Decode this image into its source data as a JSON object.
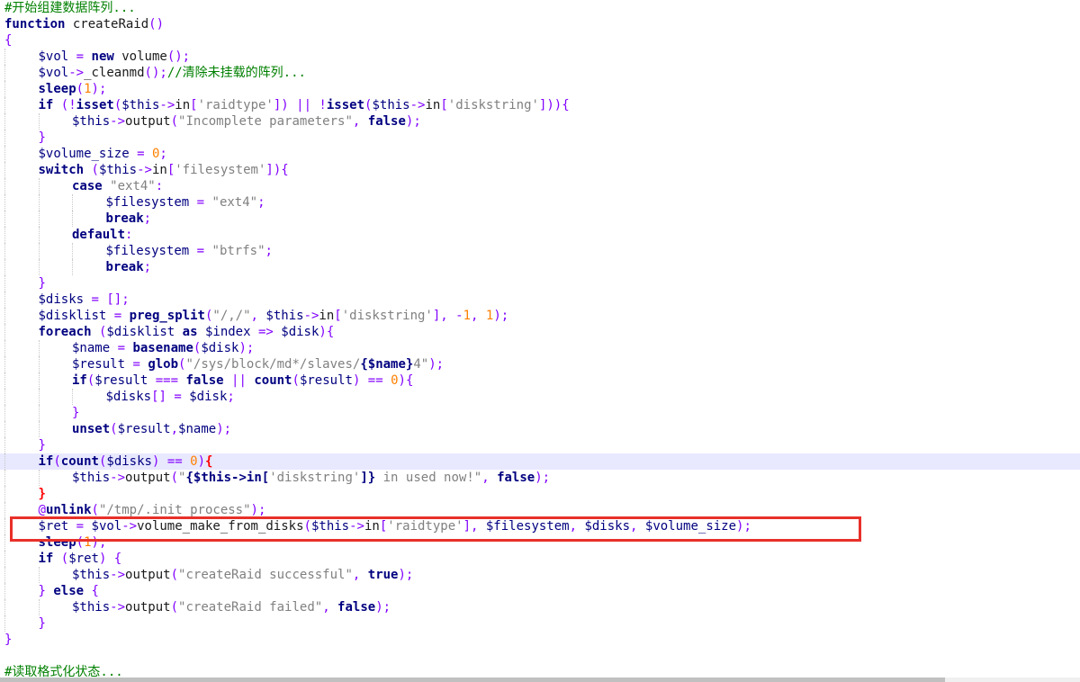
{
  "editor": {
    "lines": [
      {
        "indent": 0,
        "tokens": [
          [
            "cmt",
            "#开始组建数据阵列..."
          ]
        ]
      },
      {
        "indent": 0,
        "tokens": [
          [
            "kw",
            "function"
          ],
          [
            "plain",
            " createRaid"
          ],
          [
            "op",
            "()"
          ]
        ]
      },
      {
        "indent": 0,
        "tokens": [
          [
            "op",
            "{"
          ]
        ]
      },
      {
        "indent": 1,
        "tokens": [
          [
            "var",
            "$vol"
          ],
          [
            "op",
            " = "
          ],
          [
            "kw",
            "new"
          ],
          [
            "plain",
            " volume"
          ],
          [
            "op",
            "();"
          ]
        ]
      },
      {
        "indent": 1,
        "tokens": [
          [
            "var",
            "$vol"
          ],
          [
            "op",
            "->"
          ],
          [
            "plain",
            "_cleanmd"
          ],
          [
            "op",
            "();"
          ],
          [
            "cmt",
            "//清除未挂载的阵列..."
          ]
        ]
      },
      {
        "indent": 1,
        "tokens": [
          [
            "fn",
            "sleep"
          ],
          [
            "op",
            "("
          ],
          [
            "num",
            "1"
          ],
          [
            "op",
            ");"
          ]
        ]
      },
      {
        "indent": 1,
        "tokens": [
          [
            "kw",
            "if"
          ],
          [
            "op",
            " (!"
          ],
          [
            "fn",
            "isset"
          ],
          [
            "op",
            "("
          ],
          [
            "var",
            "$this"
          ],
          [
            "op",
            "->"
          ],
          [
            "plain",
            "in"
          ],
          [
            "op",
            "["
          ],
          [
            "str",
            "'raidtype'"
          ],
          [
            "op",
            "]) || !"
          ],
          [
            "fn",
            "isset"
          ],
          [
            "op",
            "("
          ],
          [
            "var",
            "$this"
          ],
          [
            "op",
            "->"
          ],
          [
            "plain",
            "in"
          ],
          [
            "op",
            "["
          ],
          [
            "str",
            "'diskstring'"
          ],
          [
            "op",
            "])){"
          ]
        ]
      },
      {
        "indent": 2,
        "tokens": [
          [
            "var",
            "$this"
          ],
          [
            "op",
            "->"
          ],
          [
            "plain",
            "output"
          ],
          [
            "op",
            "("
          ],
          [
            "str",
            "\"Incomplete parameters\""
          ],
          [
            "op",
            ", "
          ],
          [
            "kw",
            "false"
          ],
          [
            "op",
            ");"
          ]
        ]
      },
      {
        "indent": 1,
        "tokens": [
          [
            "op",
            "}"
          ]
        ]
      },
      {
        "indent": 1,
        "tokens": [
          [
            "var",
            "$volume_size"
          ],
          [
            "op",
            " = "
          ],
          [
            "num",
            "0"
          ],
          [
            "op",
            ";"
          ]
        ]
      },
      {
        "indent": 1,
        "tokens": [
          [
            "kw",
            "switch"
          ],
          [
            "op",
            " ("
          ],
          [
            "var",
            "$this"
          ],
          [
            "op",
            "->"
          ],
          [
            "plain",
            "in"
          ],
          [
            "op",
            "["
          ],
          [
            "str",
            "'filesystem'"
          ],
          [
            "op",
            "]){"
          ]
        ]
      },
      {
        "indent": 2,
        "tokens": [
          [
            "kw",
            "case"
          ],
          [
            "plain",
            " "
          ],
          [
            "str",
            "\"ext4\""
          ],
          [
            "op",
            ":"
          ]
        ]
      },
      {
        "indent": 3,
        "tokens": [
          [
            "var",
            "$filesystem"
          ],
          [
            "op",
            " = "
          ],
          [
            "str",
            "\"ext4\""
          ],
          [
            "op",
            ";"
          ]
        ]
      },
      {
        "indent": 3,
        "tokens": [
          [
            "kw",
            "break"
          ],
          [
            "op",
            ";"
          ]
        ]
      },
      {
        "indent": 2,
        "tokens": [
          [
            "kw",
            "default"
          ],
          [
            "op",
            ":"
          ]
        ]
      },
      {
        "indent": 3,
        "tokens": [
          [
            "var",
            "$filesystem"
          ],
          [
            "op",
            " = "
          ],
          [
            "str",
            "\"btrfs\""
          ],
          [
            "op",
            ";"
          ]
        ]
      },
      {
        "indent": 3,
        "tokens": [
          [
            "kw",
            "break"
          ],
          [
            "op",
            ";"
          ]
        ]
      },
      {
        "indent": 1,
        "tokens": [
          [
            "op",
            "}"
          ]
        ]
      },
      {
        "indent": 1,
        "tokens": [
          [
            "var",
            "$disks"
          ],
          [
            "op",
            " = [];"
          ]
        ]
      },
      {
        "indent": 1,
        "tokens": [
          [
            "var",
            "$disklist"
          ],
          [
            "op",
            " = "
          ],
          [
            "fn",
            "preg_split"
          ],
          [
            "op",
            "("
          ],
          [
            "str",
            "\"/,/\""
          ],
          [
            "op",
            ", "
          ],
          [
            "var",
            "$this"
          ],
          [
            "op",
            "->"
          ],
          [
            "plain",
            "in"
          ],
          [
            "op",
            "["
          ],
          [
            "str",
            "'diskstring'"
          ],
          [
            "op",
            "], -"
          ],
          [
            "num",
            "1"
          ],
          [
            "op",
            ", "
          ],
          [
            "num",
            "1"
          ],
          [
            "op",
            ");"
          ]
        ]
      },
      {
        "indent": 1,
        "tokens": [
          [
            "kw",
            "foreach"
          ],
          [
            "op",
            " ("
          ],
          [
            "var",
            "$disklist"
          ],
          [
            "plain",
            " "
          ],
          [
            "kw",
            "as"
          ],
          [
            "plain",
            " "
          ],
          [
            "var",
            "$index"
          ],
          [
            "op",
            " => "
          ],
          [
            "var",
            "$disk"
          ],
          [
            "op",
            "){"
          ]
        ]
      },
      {
        "indent": 2,
        "tokens": [
          [
            "var",
            "$name"
          ],
          [
            "op",
            " = "
          ],
          [
            "fn",
            "basename"
          ],
          [
            "op",
            "("
          ],
          [
            "var",
            "$disk"
          ],
          [
            "op",
            ");"
          ]
        ]
      },
      {
        "indent": 2,
        "tokens": [
          [
            "var",
            "$result"
          ],
          [
            "op",
            " = "
          ],
          [
            "fn",
            "glob"
          ],
          [
            "op",
            "("
          ],
          [
            "str",
            "\"/sys/block/md*/slaves/"
          ],
          [
            "fn",
            "{$name}"
          ],
          [
            "str",
            "4\""
          ],
          [
            "op",
            ");"
          ]
        ]
      },
      {
        "indent": 2,
        "tokens": [
          [
            "kw",
            "if"
          ],
          [
            "op",
            "("
          ],
          [
            "var",
            "$result"
          ],
          [
            "op",
            " === "
          ],
          [
            "kw",
            "false"
          ],
          [
            "op",
            " || "
          ],
          [
            "fn",
            "count"
          ],
          [
            "op",
            "("
          ],
          [
            "var",
            "$result"
          ],
          [
            "op",
            ") == "
          ],
          [
            "num",
            "0"
          ],
          [
            "op",
            "){"
          ]
        ]
      },
      {
        "indent": 3,
        "tokens": [
          [
            "var",
            "$disks"
          ],
          [
            "op",
            "[] = "
          ],
          [
            "var",
            "$disk"
          ],
          [
            "op",
            ";"
          ]
        ]
      },
      {
        "indent": 2,
        "tokens": [
          [
            "op",
            "}"
          ]
        ]
      },
      {
        "indent": 2,
        "tokens": [
          [
            "fn",
            "unset"
          ],
          [
            "op",
            "("
          ],
          [
            "var",
            "$result"
          ],
          [
            "op",
            ","
          ],
          [
            "var",
            "$name"
          ],
          [
            "op",
            ");"
          ]
        ]
      },
      {
        "indent": 1,
        "tokens": [
          [
            "op",
            "}"
          ]
        ]
      },
      {
        "indent": 1,
        "tokens": [
          [
            "kw",
            "if"
          ],
          [
            "op",
            "("
          ],
          [
            "fn",
            "count"
          ],
          [
            "op",
            "("
          ],
          [
            "var",
            "$disks"
          ],
          [
            "op",
            ") == "
          ],
          [
            "num",
            "0"
          ],
          [
            "op",
            ")"
          ],
          [
            "hl",
            "{"
          ]
        ]
      },
      {
        "indent": 2,
        "tokens": [
          [
            "var",
            "$this"
          ],
          [
            "op",
            "->"
          ],
          [
            "plain",
            "output"
          ],
          [
            "op",
            "("
          ],
          [
            "str",
            "\""
          ],
          [
            "fn",
            "{$this->in["
          ],
          [
            "str",
            "'diskstring'"
          ],
          [
            "fn",
            "]}"
          ],
          [
            "str",
            " in used now!\""
          ],
          [
            "op",
            ", "
          ],
          [
            "kw",
            "false"
          ],
          [
            "op",
            ");"
          ]
        ]
      },
      {
        "indent": 1,
        "tokens": [
          [
            "hl",
            "}"
          ]
        ]
      },
      {
        "indent": 1,
        "tokens": [
          [
            "op",
            "@"
          ],
          [
            "fn",
            "unlink"
          ],
          [
            "op",
            "("
          ],
          [
            "str",
            "\"/tmp/.init_process\""
          ],
          [
            "op",
            ");"
          ]
        ]
      },
      {
        "indent": 1,
        "tokens": [
          [
            "var",
            "$ret"
          ],
          [
            "op",
            " = "
          ],
          [
            "var",
            "$vol"
          ],
          [
            "op",
            "->"
          ],
          [
            "plain",
            "volume_make_from_disks"
          ],
          [
            "op",
            "("
          ],
          [
            "var",
            "$this"
          ],
          [
            "op",
            "->"
          ],
          [
            "plain",
            "in"
          ],
          [
            "op",
            "["
          ],
          [
            "str",
            "'raidtype'"
          ],
          [
            "op",
            "], "
          ],
          [
            "var",
            "$filesystem"
          ],
          [
            "op",
            ", "
          ],
          [
            "var",
            "$disks"
          ],
          [
            "op",
            ", "
          ],
          [
            "var",
            "$volume_size"
          ],
          [
            "op",
            ");"
          ]
        ]
      },
      {
        "indent": 1,
        "tokens": [
          [
            "fn",
            "sleep"
          ],
          [
            "op",
            "("
          ],
          [
            "num",
            "1"
          ],
          [
            "op",
            ");"
          ]
        ]
      },
      {
        "indent": 1,
        "tokens": [
          [
            "kw",
            "if"
          ],
          [
            "op",
            " ("
          ],
          [
            "var",
            "$ret"
          ],
          [
            "op",
            ") {"
          ]
        ]
      },
      {
        "indent": 2,
        "tokens": [
          [
            "var",
            "$this"
          ],
          [
            "op",
            "->"
          ],
          [
            "plain",
            "output"
          ],
          [
            "op",
            "("
          ],
          [
            "str",
            "\"createRaid successful\""
          ],
          [
            "op",
            ", "
          ],
          [
            "kw",
            "true"
          ],
          [
            "op",
            ");"
          ]
        ]
      },
      {
        "indent": 1,
        "tokens": [
          [
            "op",
            "} "
          ],
          [
            "kw",
            "else"
          ],
          [
            "op",
            " {"
          ]
        ]
      },
      {
        "indent": 2,
        "tokens": [
          [
            "var",
            "$this"
          ],
          [
            "op",
            "->"
          ],
          [
            "plain",
            "output"
          ],
          [
            "op",
            "("
          ],
          [
            "str",
            "\"createRaid failed\""
          ],
          [
            "op",
            ", "
          ],
          [
            "kw",
            "false"
          ],
          [
            "op",
            ");"
          ]
        ]
      },
      {
        "indent": 1,
        "tokens": [
          [
            "op",
            "}"
          ]
        ]
      },
      {
        "indent": 0,
        "tokens": [
          [
            "op",
            "}"
          ]
        ]
      },
      {
        "indent": 0,
        "tokens": []
      },
      {
        "indent": 0,
        "tokens": [
          [
            "cmt",
            "#读取格式化状态..."
          ]
        ]
      }
    ],
    "current_line_index": 28,
    "highlighted_line_index": 32
  },
  "colors": {
    "background": "#ffffff",
    "keyword": "#000080",
    "string": "#808080",
    "number": "#ff8000",
    "operator": "#8000ff",
    "comment": "#008000",
    "brace_match": "#ff0000",
    "current_line": "#e8e8ff",
    "annotation_box": "#e8302a"
  }
}
